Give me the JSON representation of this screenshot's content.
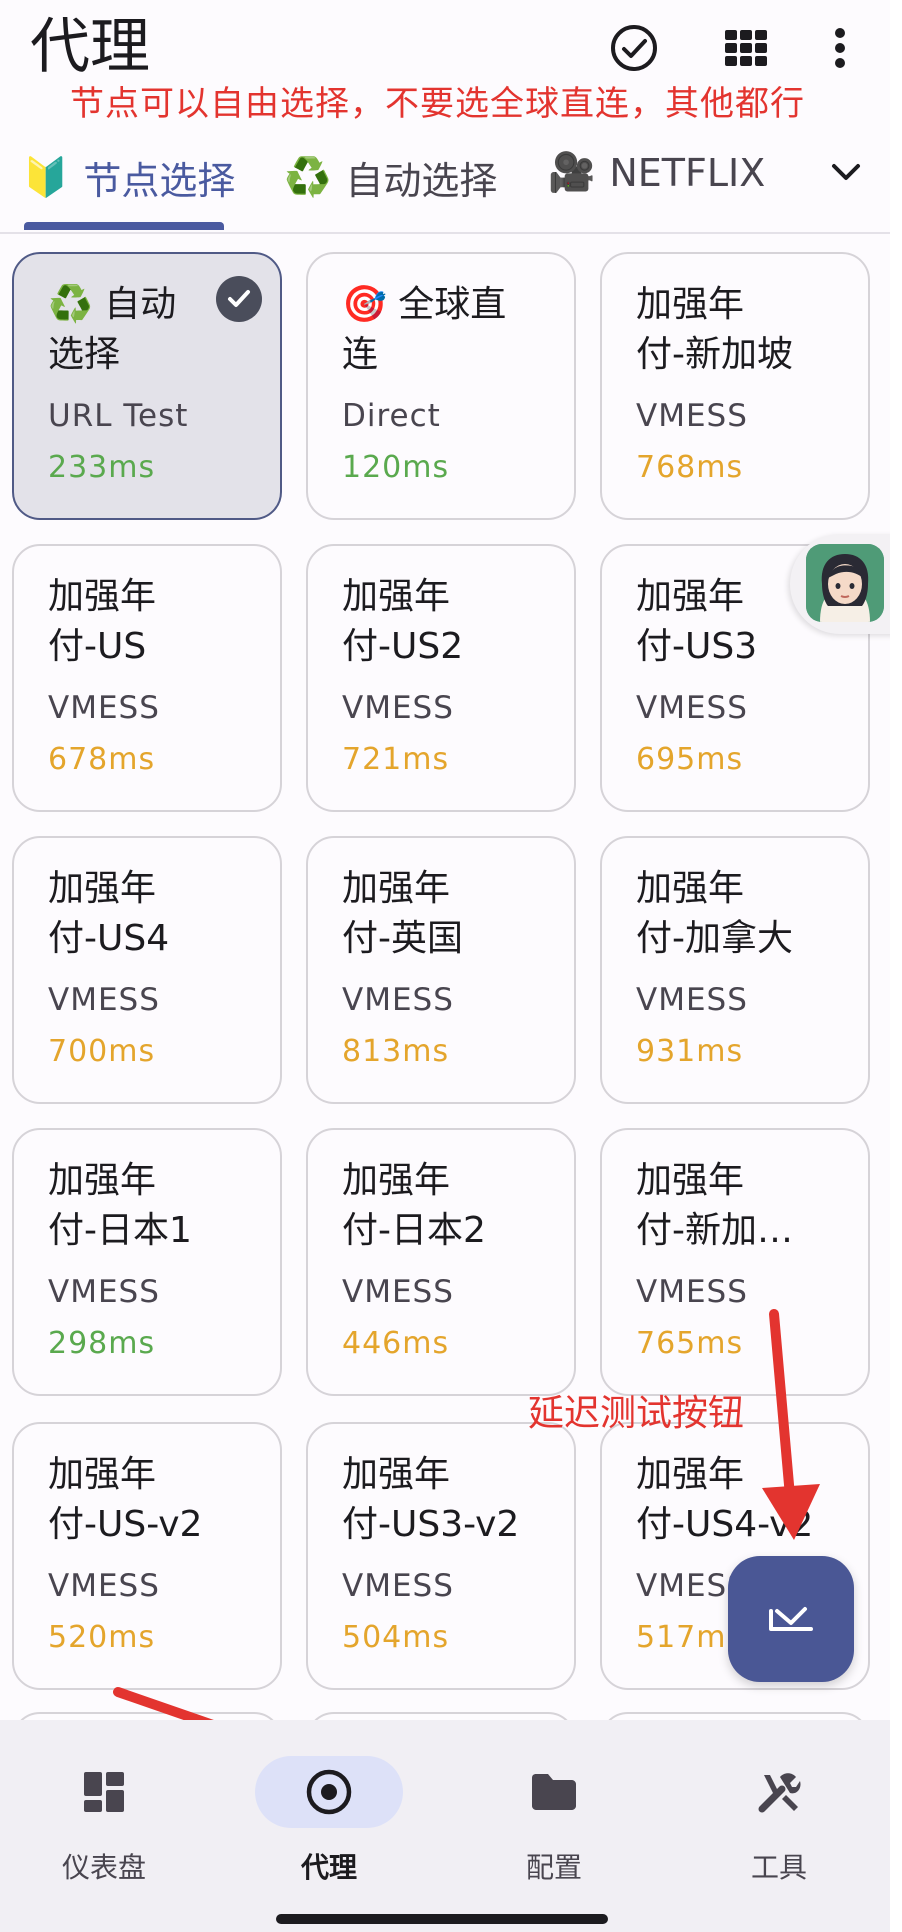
{
  "header": {
    "title": "代理",
    "annotation": "节点可以自由选择，不要选全球直连，其他都行",
    "icons": [
      "check-circle-icon",
      "grid-icon",
      "more-vert-icon"
    ]
  },
  "tabs": [
    {
      "emoji": "🔰",
      "label": "节点选择",
      "active": true
    },
    {
      "emoji": "♻️",
      "label": "自动选择",
      "active": false
    },
    {
      "emoji": "🎥",
      "label": "NETFLIX",
      "active": false
    }
  ],
  "cards": [
    {
      "emoji": "♻️",
      "name": "自动\n选择",
      "type": "URL Test",
      "delay": "233ms",
      "delay_color": "green",
      "selected": true
    },
    {
      "emoji": "🎯",
      "name": "全球直\n连",
      "type": "Direct",
      "delay": "120ms",
      "delay_color": "green",
      "selected": false
    },
    {
      "emoji": "",
      "name": "加强年\n付-新加坡",
      "type": "VMESS",
      "delay": "768ms",
      "delay_color": "orange",
      "selected": false
    },
    {
      "emoji": "",
      "name": "加强年\n付-US",
      "type": "VMESS",
      "delay": "678ms",
      "delay_color": "orange",
      "selected": false
    },
    {
      "emoji": "",
      "name": "加强年\n付-US2",
      "type": "VMESS",
      "delay": "721ms",
      "delay_color": "orange",
      "selected": false
    },
    {
      "emoji": "",
      "name": "加强年\n付-US3",
      "type": "VMESS",
      "delay": "695ms",
      "delay_color": "orange",
      "selected": false
    },
    {
      "emoji": "",
      "name": "加强年\n付-US4",
      "type": "VMESS",
      "delay": "700ms",
      "delay_color": "orange",
      "selected": false
    },
    {
      "emoji": "",
      "name": "加强年\n付-英国",
      "type": "VMESS",
      "delay": "813ms",
      "delay_color": "orange",
      "selected": false
    },
    {
      "emoji": "",
      "name": "加强年\n付-加拿大",
      "type": "VMESS",
      "delay": "931ms",
      "delay_color": "orange",
      "selected": false
    },
    {
      "emoji": "",
      "name": "加强年\n付-日本1",
      "type": "VMESS",
      "delay": "298ms",
      "delay_color": "green",
      "selected": false
    },
    {
      "emoji": "",
      "name": "加强年\n付-日本2",
      "type": "VMESS",
      "delay": "446ms",
      "delay_color": "orange",
      "selected": false
    },
    {
      "emoji": "",
      "name": "加强年\n付-新加…",
      "type": "VMESS",
      "delay": "765ms",
      "delay_color": "orange",
      "selected": false
    },
    {
      "emoji": "",
      "name": "加强年\n付-US-v2",
      "type": "VMESS",
      "delay": "520ms",
      "delay_color": "orange",
      "selected": false
    },
    {
      "emoji": "",
      "name": "加强年\n付-US3-v2",
      "type": "VMESS",
      "delay": "504ms",
      "delay_color": "orange",
      "selected": false
    },
    {
      "emoji": "",
      "name": "加强年\n付-US4-v2",
      "type": "VMESS",
      "delay": "517ms",
      "delay_color": "orange",
      "selected": false
    }
  ],
  "annotation_mid": "延迟测试按钮",
  "fab": {
    "icon": "latency-test-icon"
  },
  "bottom_nav": [
    {
      "label": "仪表盘",
      "icon": "dashboard-icon",
      "active": false
    },
    {
      "label": "代理",
      "icon": "proxy-radio-icon",
      "active": true
    },
    {
      "label": "配置",
      "icon": "folder-icon",
      "active": false
    },
    {
      "label": "工具",
      "icon": "tools-icon",
      "active": false
    }
  ],
  "colors": {
    "accent": "#4a5aa0",
    "fab": "#4a5795",
    "delay_green": "#5aa94e",
    "delay_orange": "#e4a52c",
    "annotation_red": "#e3342f"
  }
}
